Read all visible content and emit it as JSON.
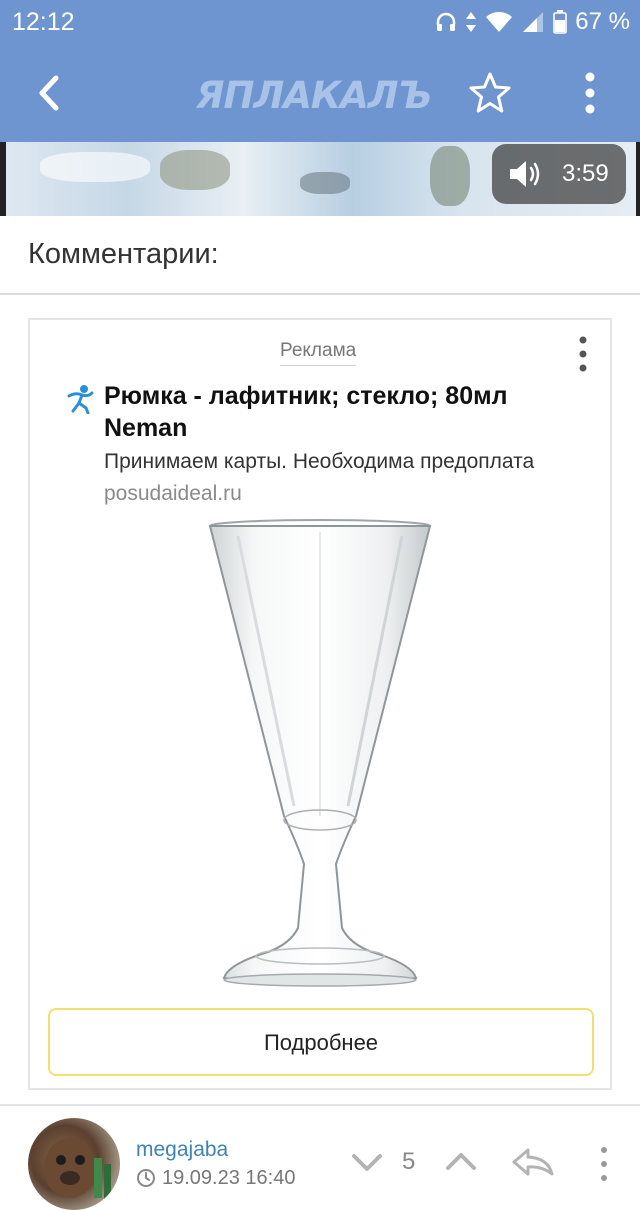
{
  "status_bar": {
    "time": "12:12",
    "battery": "67 %",
    "icons": [
      "headphones-icon",
      "data-arrows-icon",
      "wifi-icon",
      "signal-icon",
      "battery-icon"
    ]
  },
  "app_bar": {
    "logo": "ЯПЛАКАЛЪ",
    "color": "#6e95cf",
    "icons": [
      "back-arrow-icon",
      "star-icon",
      "more-vertical-icon"
    ]
  },
  "video": {
    "duration": "3:59",
    "icons": [
      "volume-icon"
    ]
  },
  "comments_section": {
    "title": "Комментарии:"
  },
  "ad": {
    "label": "Реклама",
    "title": "Рюмка - лафитник; стекло; 80мл Neman",
    "description": "Принимаем карты. Необходима предоплата",
    "domain": "posudaideal.ru",
    "cta": "Подробнее",
    "cta_border_color": "#f2df6f",
    "icons": [
      "advertiser-logo-icon",
      "more-vertical-icon"
    ]
  },
  "comment": {
    "username": "megajaba",
    "date": "19.09.23 16:40",
    "score": "5",
    "username_color": "#3e82b6",
    "icons": [
      "clock-icon",
      "downvote-icon",
      "upvote-icon",
      "reply-icon",
      "more-vertical-icon"
    ]
  }
}
